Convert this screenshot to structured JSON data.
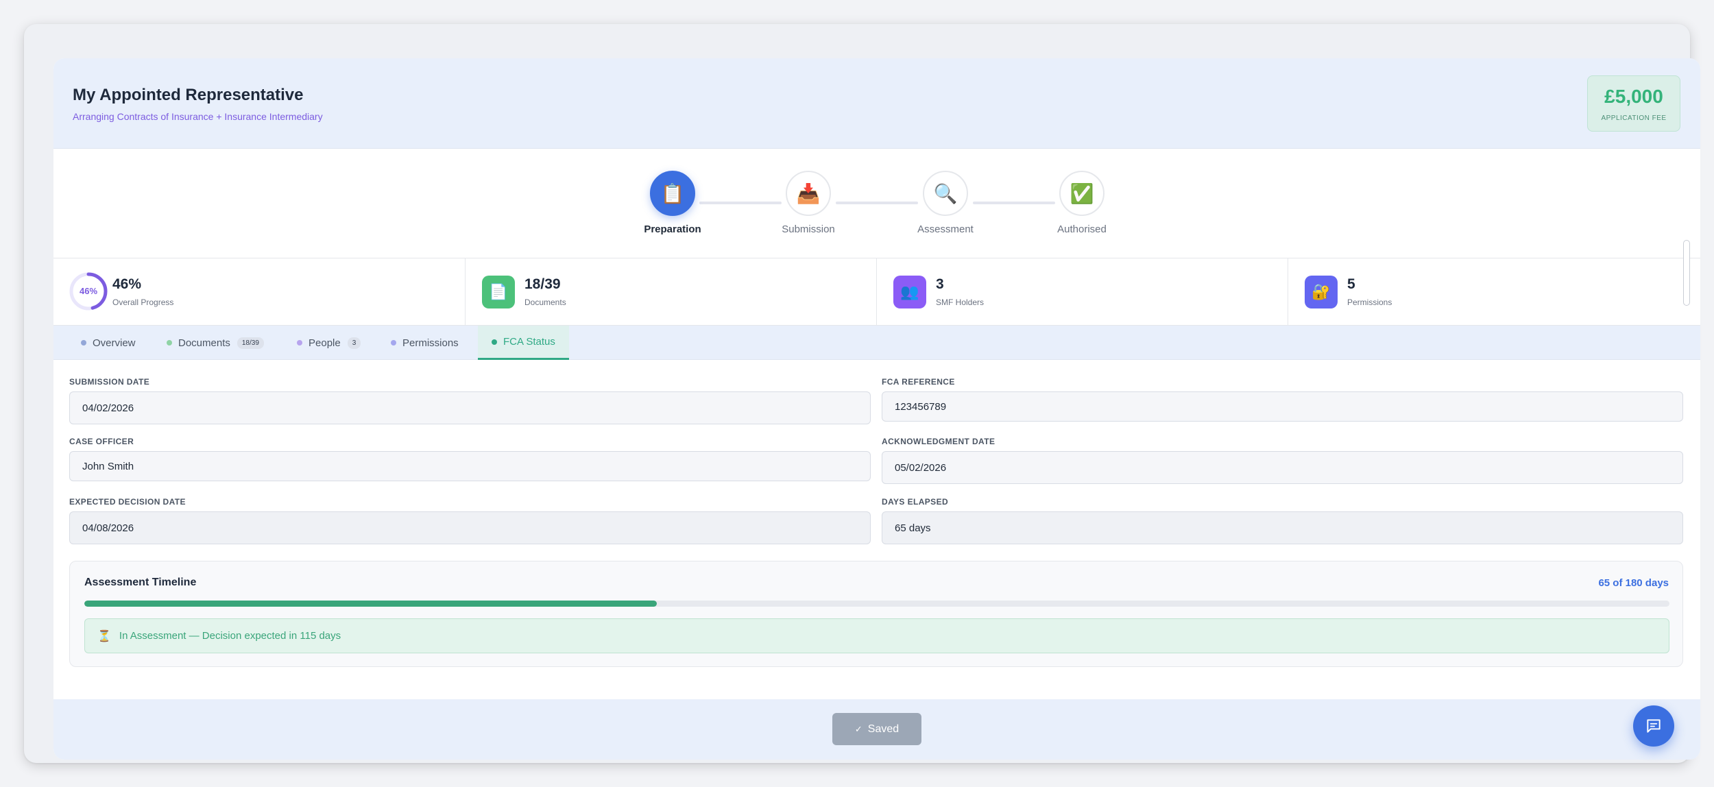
{
  "header": {
    "title": "My Appointed Representative",
    "subtitle": "Arranging Contracts of Insurance + Insurance Intermediary",
    "fee_amount": "£5,000",
    "fee_label": "APPLICATION FEE"
  },
  "stepper": {
    "steps": [
      {
        "label": "Preparation",
        "icon": "clipboard-icon",
        "glyph": "📋",
        "active": true
      },
      {
        "label": "Submission",
        "icon": "inbox-tray-icon",
        "glyph": "📥",
        "active": false
      },
      {
        "label": "Assessment",
        "icon": "magnifier-icon",
        "glyph": "🔍",
        "active": false
      },
      {
        "label": "Authorised",
        "icon": "check-mark-icon",
        "glyph": "✅",
        "active": false
      }
    ]
  },
  "stats": {
    "progress": {
      "value": "46%",
      "ring_text": "46%",
      "label": "Overall Progress",
      "fraction": 0.46,
      "color": "#7c5ce0"
    },
    "documents": {
      "value": "18/39",
      "label": "Documents",
      "icon": "document-icon",
      "glyph": "📄",
      "color": "#4cc17a"
    },
    "smf": {
      "value": "3",
      "label": "SMF Holders",
      "icon": "people-icon",
      "glyph": "👥",
      "color": "#8b5cf6"
    },
    "permissions": {
      "value": "5",
      "label": "Permissions",
      "icon": "lock-key-icon",
      "glyph": "🔐",
      "color": "#6366f1"
    }
  },
  "tabs": [
    {
      "label": "Overview",
      "badge": "",
      "dot": "#93a7d8"
    },
    {
      "label": "Documents",
      "badge": "18/39",
      "dot": "#8fd3a5"
    },
    {
      "label": "People",
      "badge": "3",
      "dot": "#b7a4ee"
    },
    {
      "label": "Permissions",
      "badge": "",
      "dot": "#a4a7ee"
    },
    {
      "label": "FCA Status",
      "badge": "",
      "dot": "#2fa985",
      "active": true
    }
  ],
  "form": {
    "submission_date": {
      "label": "SUBMISSION DATE",
      "value": "04/02/2026"
    },
    "fca_reference": {
      "label": "FCA REFERENCE",
      "value": "123456789"
    },
    "case_officer": {
      "label": "CASE OFFICER",
      "value": "John Smith"
    },
    "acknowledgment_date": {
      "label": "ACKNOWLEDGMENT DATE",
      "value": "05/02/2026"
    },
    "expected_decision_date": {
      "label": "EXPECTED DECISION DATE",
      "value": "04/08/2026"
    },
    "days_elapsed": {
      "label": "DAYS ELAPSED",
      "value": "65 days"
    }
  },
  "timeline": {
    "title": "Assessment Timeline",
    "days_text": "65 of 180 days",
    "elapsed_days": 65,
    "total_days": 180,
    "status_text": "In Assessment — Decision expected in 115 days",
    "status_icon": "hourglass-icon",
    "status_glyph": "⏳"
  },
  "footer": {
    "saved_label": "Saved",
    "check_glyph": "✓"
  },
  "chat": {
    "icon": "chat-bubble-icon"
  }
}
